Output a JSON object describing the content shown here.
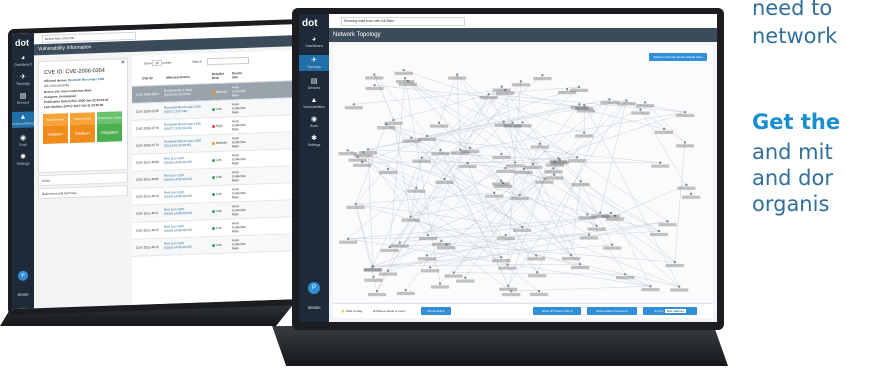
{
  "marketing": {
    "line1": "need to",
    "line2": "network",
    "line3": "Get the",
    "line4": "and mit",
    "line5": "and dor",
    "line6": "organis"
  },
  "left_app": {
    "logo": "dot",
    "nav": [
      "Dashboard",
      "Topology",
      "Devices",
      "Vulnerabilities",
      "Scan",
      "Settings"
    ],
    "selector": "Device Mon Linux Eth ...",
    "header": "Vulnerability Information",
    "cve": {
      "title": "CVE ID: CVE-2006-0354",
      "affected_label": "Affected device:",
      "affected_value": "Rockwell Micrologix 1100",
      "mac": "(00:1d:9c:a6:e6:fb)",
      "device_site": "Device site: Avon Collective Main",
      "assignee": "Assignee: Unassigned",
      "pub_date": "Publication Date (UTC): 2006-Jan-22 20:03:00",
      "last_update": "Last Updates (UTC): 2017-Oct-11 00:30:00",
      "score_labels": [
        "Base Severity",
        "Attack Vector",
        "Remediation Status"
      ],
      "score_values": [
        "Medium",
        "Medium",
        "Mitigated"
      ],
      "section1": "CVSS",
      "section2": "References and Summary"
    },
    "table": {
      "show_label": "Show",
      "show_value": "10",
      "entries_label": "entries",
      "search_label": "Search:",
      "headers": [
        "CVE ID",
        "Affected Device",
        "Relative Risk",
        "Device Site"
      ],
      "rows": [
        {
          "id": "CVE-2006-0354",
          "device": "Rockwell MLX 1100 (00:1d:9c:a6:e6:fb)",
          "risk": "Medium",
          "site": "Avon Collective Main"
        },
        {
          "id": "CVE-2009-0735",
          "device": "Rockwell MicroLogix 1100 (00:07:15:67:00)",
          "risk": "Low",
          "site": "Avon Collective Main"
        },
        {
          "id": "CVE-2009-3770",
          "device": "Rockwell MicroLogix 1100 (00:07:15:91:94:00)",
          "risk": "High",
          "site": "Avon Collective Main"
        },
        {
          "id": "CVE-2009-3772",
          "device": "Rockwell MicroLogix 1400 (00:1d:9c:a6:e6:fb)",
          "risk": "Medium",
          "site": "Avon Collective Main"
        },
        {
          "id": "CVE-2011-4500",
          "device": "Red Lion G09 (00:05:e4:0b:43:09)",
          "risk": "Low",
          "site": "Avon Collective Main"
        },
        {
          "id": "CVE-2011-4606",
          "device": "Red Lion G09 (00:05:e4:0b:43:09)",
          "risk": "Low",
          "site": "Avon Collective Main"
        },
        {
          "id": "CVE-2011-4610",
          "device": "Red Lion G09 (00:05:e4:0b:43:09)",
          "risk": "Low",
          "site": "Avon Collective Main"
        },
        {
          "id": "CVE-2011-4611",
          "device": "Red Lion G09 (00:05:e4:0b:43:09)",
          "risk": "Low",
          "site": "Avon Collective Main"
        },
        {
          "id": "CVE-2011-4612",
          "device": "Red Lion G09 (00:05:e4:0b:43:09)",
          "risk": "Low",
          "site": "Avon Collective Main"
        },
        {
          "id": "CVE-2011-4613",
          "device": "Red Lion G09 (00:05:e4:0b:43:09)",
          "risk": "Low",
          "site": "Avon Collective Main"
        }
      ]
    },
    "user_badge": "P",
    "brand": "SENSEI"
  },
  "right_app": {
    "logo": "dot",
    "nav": [
      "Dashboard",
      "Topology",
      "Devices",
      "Vulnerabilities",
      "Scan",
      "Settings"
    ],
    "selector": "Showing data from site: All Sites",
    "header": "Network Topology",
    "top_button": "Switch to Purdue Device Model View",
    "footer": {
      "click_drag": "Click to drag",
      "mouse_wheel": "Mouse wheel to zoom",
      "reset": "Reset Graph",
      "show_ip": "Show IP Device Only",
      "show_hidden": "Show hidden Devices",
      "sort_label": "Sort by",
      "sort_value": "Mac address"
    },
    "user_badge": "P",
    "brand": "SENSEI",
    "colors": {
      "accent": "#2f8fd8",
      "sidebar": "#1e2a38",
      "header": "#3c4b5a",
      "medium": "#f0a020",
      "high": "#e8453c",
      "low": "#3aa655",
      "mitigated": "#4caf50"
    }
  }
}
